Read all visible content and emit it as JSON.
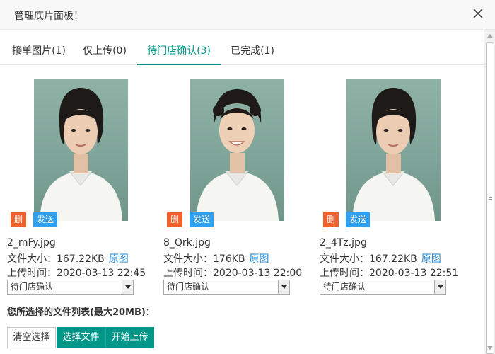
{
  "dialog": {
    "title": "管理底片面板！",
    "close_icon": "close-icon"
  },
  "tabs": [
    {
      "label": "接单图片(1)",
      "active": false
    },
    {
      "label": "仅上传(0)",
      "active": false
    },
    {
      "label": "待门店确认(3)",
      "active": true
    },
    {
      "label": "已完成(1)",
      "active": false
    }
  ],
  "cards": [
    {
      "delete_label": "删",
      "send_label": "发送",
      "filename": "2_mFy.jpg",
      "size_label": "文件大小：167.22KB",
      "original_link": "原图",
      "time_label": "上传时间：2020-03-13 22:45",
      "status": "待门店确认"
    },
    {
      "delete_label": "删",
      "send_label": "发送",
      "filename": "8_Qrk.jpg",
      "size_label": "文件大小：176KB",
      "original_link": "原图",
      "time_label": "上传时间：2020-03-13 22:00",
      "status": "待门店确认"
    },
    {
      "delete_label": "删",
      "send_label": "发送",
      "filename": "2_4Tz.jpg",
      "size_label": "文件大小：167.22KB",
      "original_link": "原图",
      "time_label": "上传时间：2020-03-13 22:51",
      "status": "待门店确认"
    }
  ],
  "file_list_title": "您所选择的文件列表(最大20MB)：",
  "actions": {
    "clear": "清空选择",
    "choose": "选择文件",
    "upload": "开始上传"
  },
  "colors": {
    "accent": "#009688",
    "delete": "#f0602a",
    "send": "#2f9ff0",
    "link": "#1e87d6"
  }
}
